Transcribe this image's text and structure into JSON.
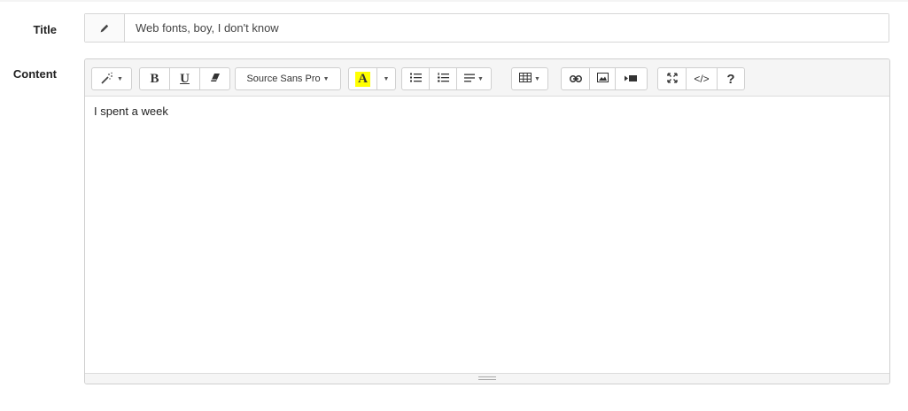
{
  "form": {
    "title_label": "Title",
    "title_value": "Web fonts, boy, I don't know",
    "content_label": "Content"
  },
  "editor": {
    "font_name": "Source Sans Pro",
    "code_label": "</>",
    "help_label": "?",
    "highlight_letter": "A",
    "highlight_color": "#ffff00",
    "body_text": "I spent a week"
  },
  "icons": {
    "title_addon": "pencil-icon",
    "toolbar": [
      "magic-wand-icon",
      "bold-icon",
      "underline-icon",
      "eraser-icon",
      "font-color-icon",
      "unordered-list-icon",
      "ordered-list-icon",
      "align-icon",
      "table-icon",
      "link-icon",
      "picture-icon",
      "video-icon",
      "fullscreen-icon",
      "code-view-icon",
      "help-icon"
    ]
  }
}
